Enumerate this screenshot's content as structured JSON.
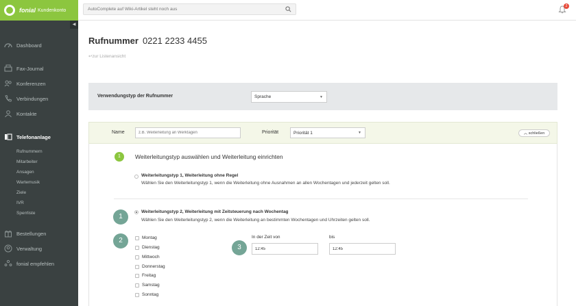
{
  "brand": {
    "name": "fonial",
    "sub": "Kundenkonto"
  },
  "search": {
    "placeholder": "AutoComplete auf Wiki-Artikel steht noch aus"
  },
  "notifications": {
    "count": "2"
  },
  "sidebar": {
    "items": [
      {
        "label": "Dashboard",
        "icon": "dashboard-icon"
      },
      {
        "label": "Fax-Journal",
        "icon": "fax-icon"
      },
      {
        "label": "Konferenzen",
        "icon": "conference-icon"
      },
      {
        "label": "Verbindungen",
        "icon": "phone-icon"
      },
      {
        "label": "Kontakte",
        "icon": "contacts-icon"
      },
      {
        "label": "Telefonanlage",
        "icon": "telephone-system-icon",
        "active": true
      },
      {
        "label": "Bestellungen",
        "icon": "orders-icon"
      },
      {
        "label": "Verwaltung",
        "icon": "user-icon"
      },
      {
        "label": "fonial empfehlen",
        "icon": "share-icon"
      }
    ],
    "subitems": [
      "Rufnummern",
      "Mitarbeiter",
      "Ansagen",
      "Wartemusik",
      "Ziele",
      "IVR",
      "Sperrliste"
    ]
  },
  "page": {
    "title": "Rufnummer",
    "number": "0221 2233 4455",
    "back": "zur Listenansicht"
  },
  "usage": {
    "label": "Verwendungstyp der Rufnummer",
    "value": "Sprache"
  },
  "rule": {
    "name_label": "Name",
    "name_placeholder": "z.B. Weiterleitung an Werktagen",
    "priority_label": "Priorität",
    "priority_value": "Priorität 1",
    "close_label": "schließen"
  },
  "section": {
    "step": "1",
    "title": "Weiterleitungstyp auswählen und Weiterleitung einrichten",
    "option1": {
      "title": "Weiterleitungstyp 1, Weiterleitung ohne Regel",
      "desc": "Wählen Sie den Weiterleitungstyp 1, wenn die Weiterleitung ohne Ausnahmen an allen Wochentagen und jederzeit gelten soll."
    },
    "option2": {
      "title": "Weiterleitungstyp 2, Weiterleitung mit Zeitsteuerung nach Wochentag",
      "desc": "Wählen Sie den Weiterleitungstyp 2, wenn die Weiterleitung an bestimmten Wochentagen und Uhrzeiten gelten soll."
    }
  },
  "badges": [
    "1",
    "2",
    "3"
  ],
  "days": [
    "Montag",
    "Dienstag",
    "Mittwoch",
    "Donnerstag",
    "Freitag",
    "Samstag",
    "Sonntag"
  ],
  "time": {
    "from_label": "In der Zeit von",
    "from_value": "12:45",
    "to_label": "bis",
    "to_value": "12:45"
  },
  "colors": {
    "brand": "#8cc63f",
    "sidebar": "#3a4141",
    "step_badge": "#74a596"
  }
}
